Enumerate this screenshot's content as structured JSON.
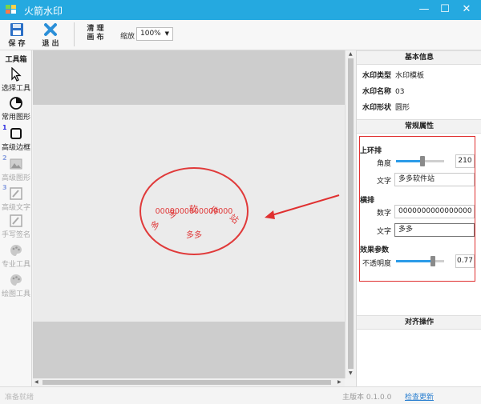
{
  "app": {
    "title": "火箭水印"
  },
  "toolbar": {
    "save_label": "保 存",
    "exit_label": "退 出",
    "clear_label_1": "清 理",
    "clear_label_2": "画 布",
    "zoom_label": "缩放",
    "zoom_value": "100%"
  },
  "left_tools": {
    "heading": "工具箱",
    "items": [
      {
        "label": "选择工具",
        "icon": "cursor-icon"
      },
      {
        "label": "常用图形",
        "icon": "shape-icon"
      },
      {
        "label": "高级边框",
        "icon": "border-icon",
        "num": "1"
      },
      {
        "label": "高级图形",
        "icon": "image-icon",
        "num": "2"
      },
      {
        "label": "高级文字",
        "icon": "text-edit-icon",
        "num": "3"
      },
      {
        "label": "手写签名",
        "icon": "signature-icon"
      },
      {
        "label": "专业工具",
        "icon": "palette-icon"
      },
      {
        "label": "绘图工具",
        "icon": "paint-icon"
      }
    ]
  },
  "stamp": {
    "top_text": "多多软件站",
    "middle_number": "0000000000000000",
    "bottom_text": "多多",
    "color": "#e03a3a"
  },
  "basic_info": {
    "heading": "基本信息",
    "type_label": "水印类型",
    "type_value": "水印模板",
    "name_label": "水印名称",
    "name_value": "03",
    "shape_label": "水印形状",
    "shape_value": "圆形"
  },
  "properties": {
    "heading": "常规属性",
    "ring": {
      "title": "上环排",
      "angle_label": "角度",
      "angle_value": "210",
      "angle_fraction": 0.55,
      "text_label": "文字",
      "text_value": "多多软件站"
    },
    "horizontal": {
      "title": "横排",
      "number_label": "数字",
      "number_value": "0000000000000000",
      "text_label": "文字",
      "text_value": "多多"
    },
    "effect": {
      "title": "效果参数",
      "opacity_label": "不透明度",
      "opacity_value": "0.77",
      "opacity_fraction": 0.77
    }
  },
  "align": {
    "heading": "对齐操作"
  },
  "status": {
    "left_text": "准备就绪",
    "version_text": "主版本 0.1.0.0",
    "update_link": "检查更新"
  },
  "colors": {
    "title_bar": "#25a9e0",
    "stamp_red": "#e03a3a",
    "highlight_red": "#e03030",
    "accent_blue": "#2b9be8"
  }
}
